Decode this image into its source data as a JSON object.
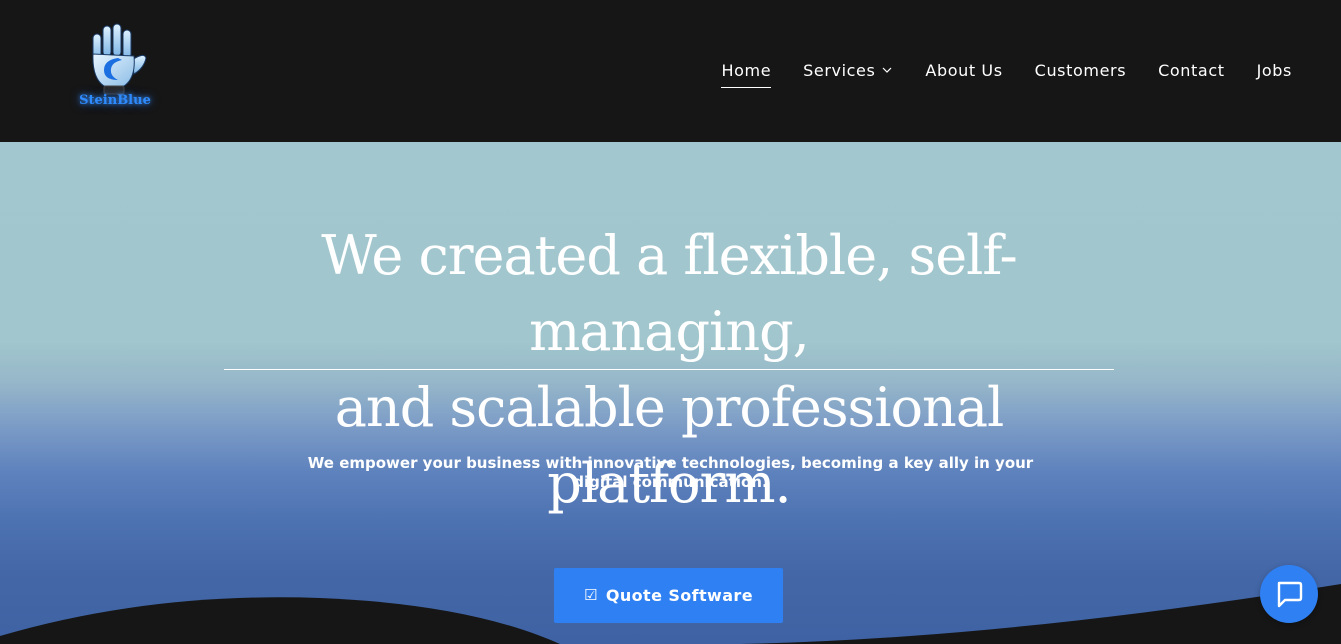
{
  "header": {
    "logo_text": "SteinBlue",
    "nav": [
      {
        "label": "Home",
        "active": true
      },
      {
        "label": "Services",
        "has_dropdown": true
      },
      {
        "label": "About Us"
      },
      {
        "label": "Customers"
      },
      {
        "label": "Contact"
      },
      {
        "label": "Jobs"
      }
    ]
  },
  "hero": {
    "title_line1": "We created a flexible, self-managing,",
    "title_line2": "and scalable professional platform.",
    "subtitle_line1": "We empower your business with innovative technologies, becoming a key ally in your",
    "subtitle_line2": "digital communication.",
    "cta_icon": "☑",
    "cta_label": "Quote Software"
  },
  "chat": {
    "icon": "chat-bubble-icon"
  },
  "colors": {
    "header_bg": "#161616",
    "accent": "#2f80f2",
    "hero_top": "#a3c7cf",
    "hero_bottom": "#3e62a3"
  }
}
